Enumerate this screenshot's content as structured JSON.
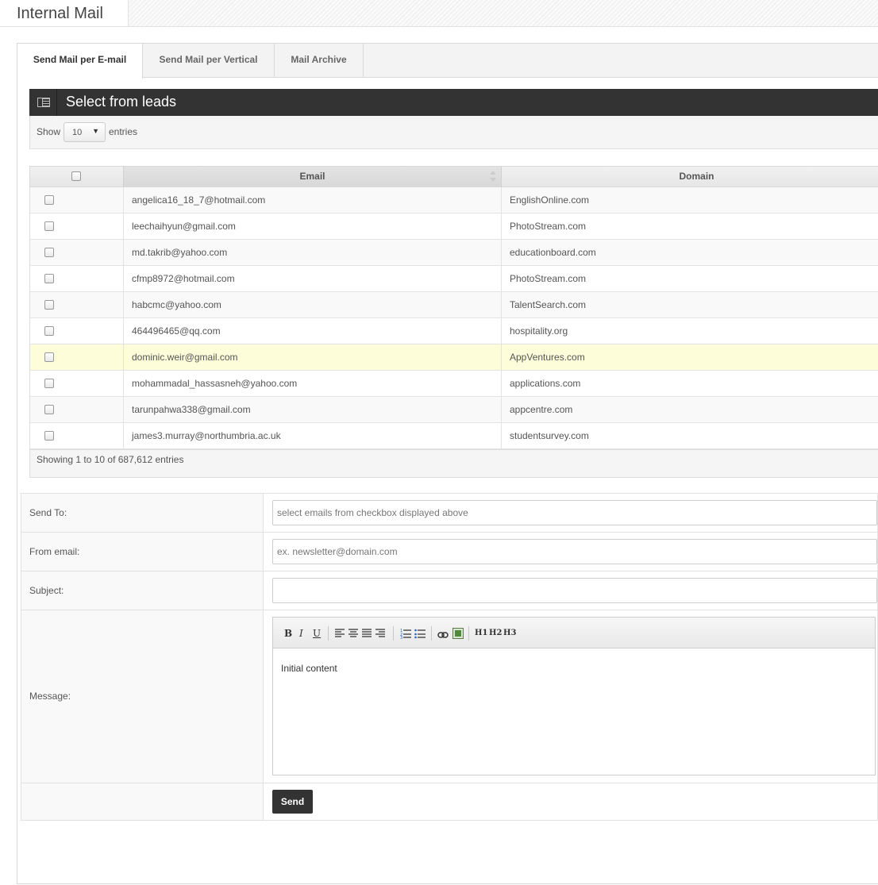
{
  "page": {
    "title": "Internal Mail"
  },
  "tabs": [
    {
      "label": "Send Mail per E-mail",
      "active": true
    },
    {
      "label": "Send Mail per Vertical",
      "active": false
    },
    {
      "label": "Mail Archive",
      "active": false
    }
  ],
  "widget": {
    "title": "Select from leads",
    "icon": "table-icon"
  },
  "toolbar": {
    "show_label": "Show",
    "page_size": "10",
    "entries_label": "entries"
  },
  "table": {
    "columns": [
      "Email",
      "Domain"
    ],
    "rows": [
      {
        "email": "angelica16_18_7@hotmail.com",
        "domain": "EnglishOnline.com"
      },
      {
        "email": "leechaihyun@gmail.com",
        "domain": "PhotoStream.com"
      },
      {
        "email": "md.takrib@yahoo.com",
        "domain": "educationboard.com"
      },
      {
        "email": "cfmp8972@hotmail.com",
        "domain": "PhotoStream.com"
      },
      {
        "email": "habcmc@yahoo.com",
        "domain": "TalentSearch.com"
      },
      {
        "email": "464496465@qq.com",
        "domain": "hospitality.org"
      },
      {
        "email": "dominic.weir@gmail.com",
        "domain": "AppVentures.com"
      },
      {
        "email": "mohammadal_hassasneh@yahoo.com",
        "domain": "applications.com"
      },
      {
        "email": "tarunpahwa338@gmail.com",
        "domain": "appcentre.com"
      },
      {
        "email": "james3.murray@northumbria.ac.uk",
        "domain": "studentsurvey.com"
      }
    ],
    "highlighted_row": 6,
    "info": "Showing 1 to 10 of 687,612 entries"
  },
  "form": {
    "send_to": {
      "label": "Send To:",
      "placeholder": "select emails from checkbox displayed above"
    },
    "from_email": {
      "label": "From email:",
      "placeholder": "ex. newsletter@domain.com"
    },
    "subject": {
      "label": "Subject:",
      "value": ""
    },
    "message": {
      "label": "Message:",
      "content": "Initial content",
      "toolbar": [
        "B",
        "I",
        "U",
        "H1",
        "H2",
        "H3"
      ]
    },
    "send_label": "Send"
  },
  "colors": {
    "header_dark": "#333333",
    "highlight_row": "#fdfdd9",
    "send_button": "#333333"
  }
}
